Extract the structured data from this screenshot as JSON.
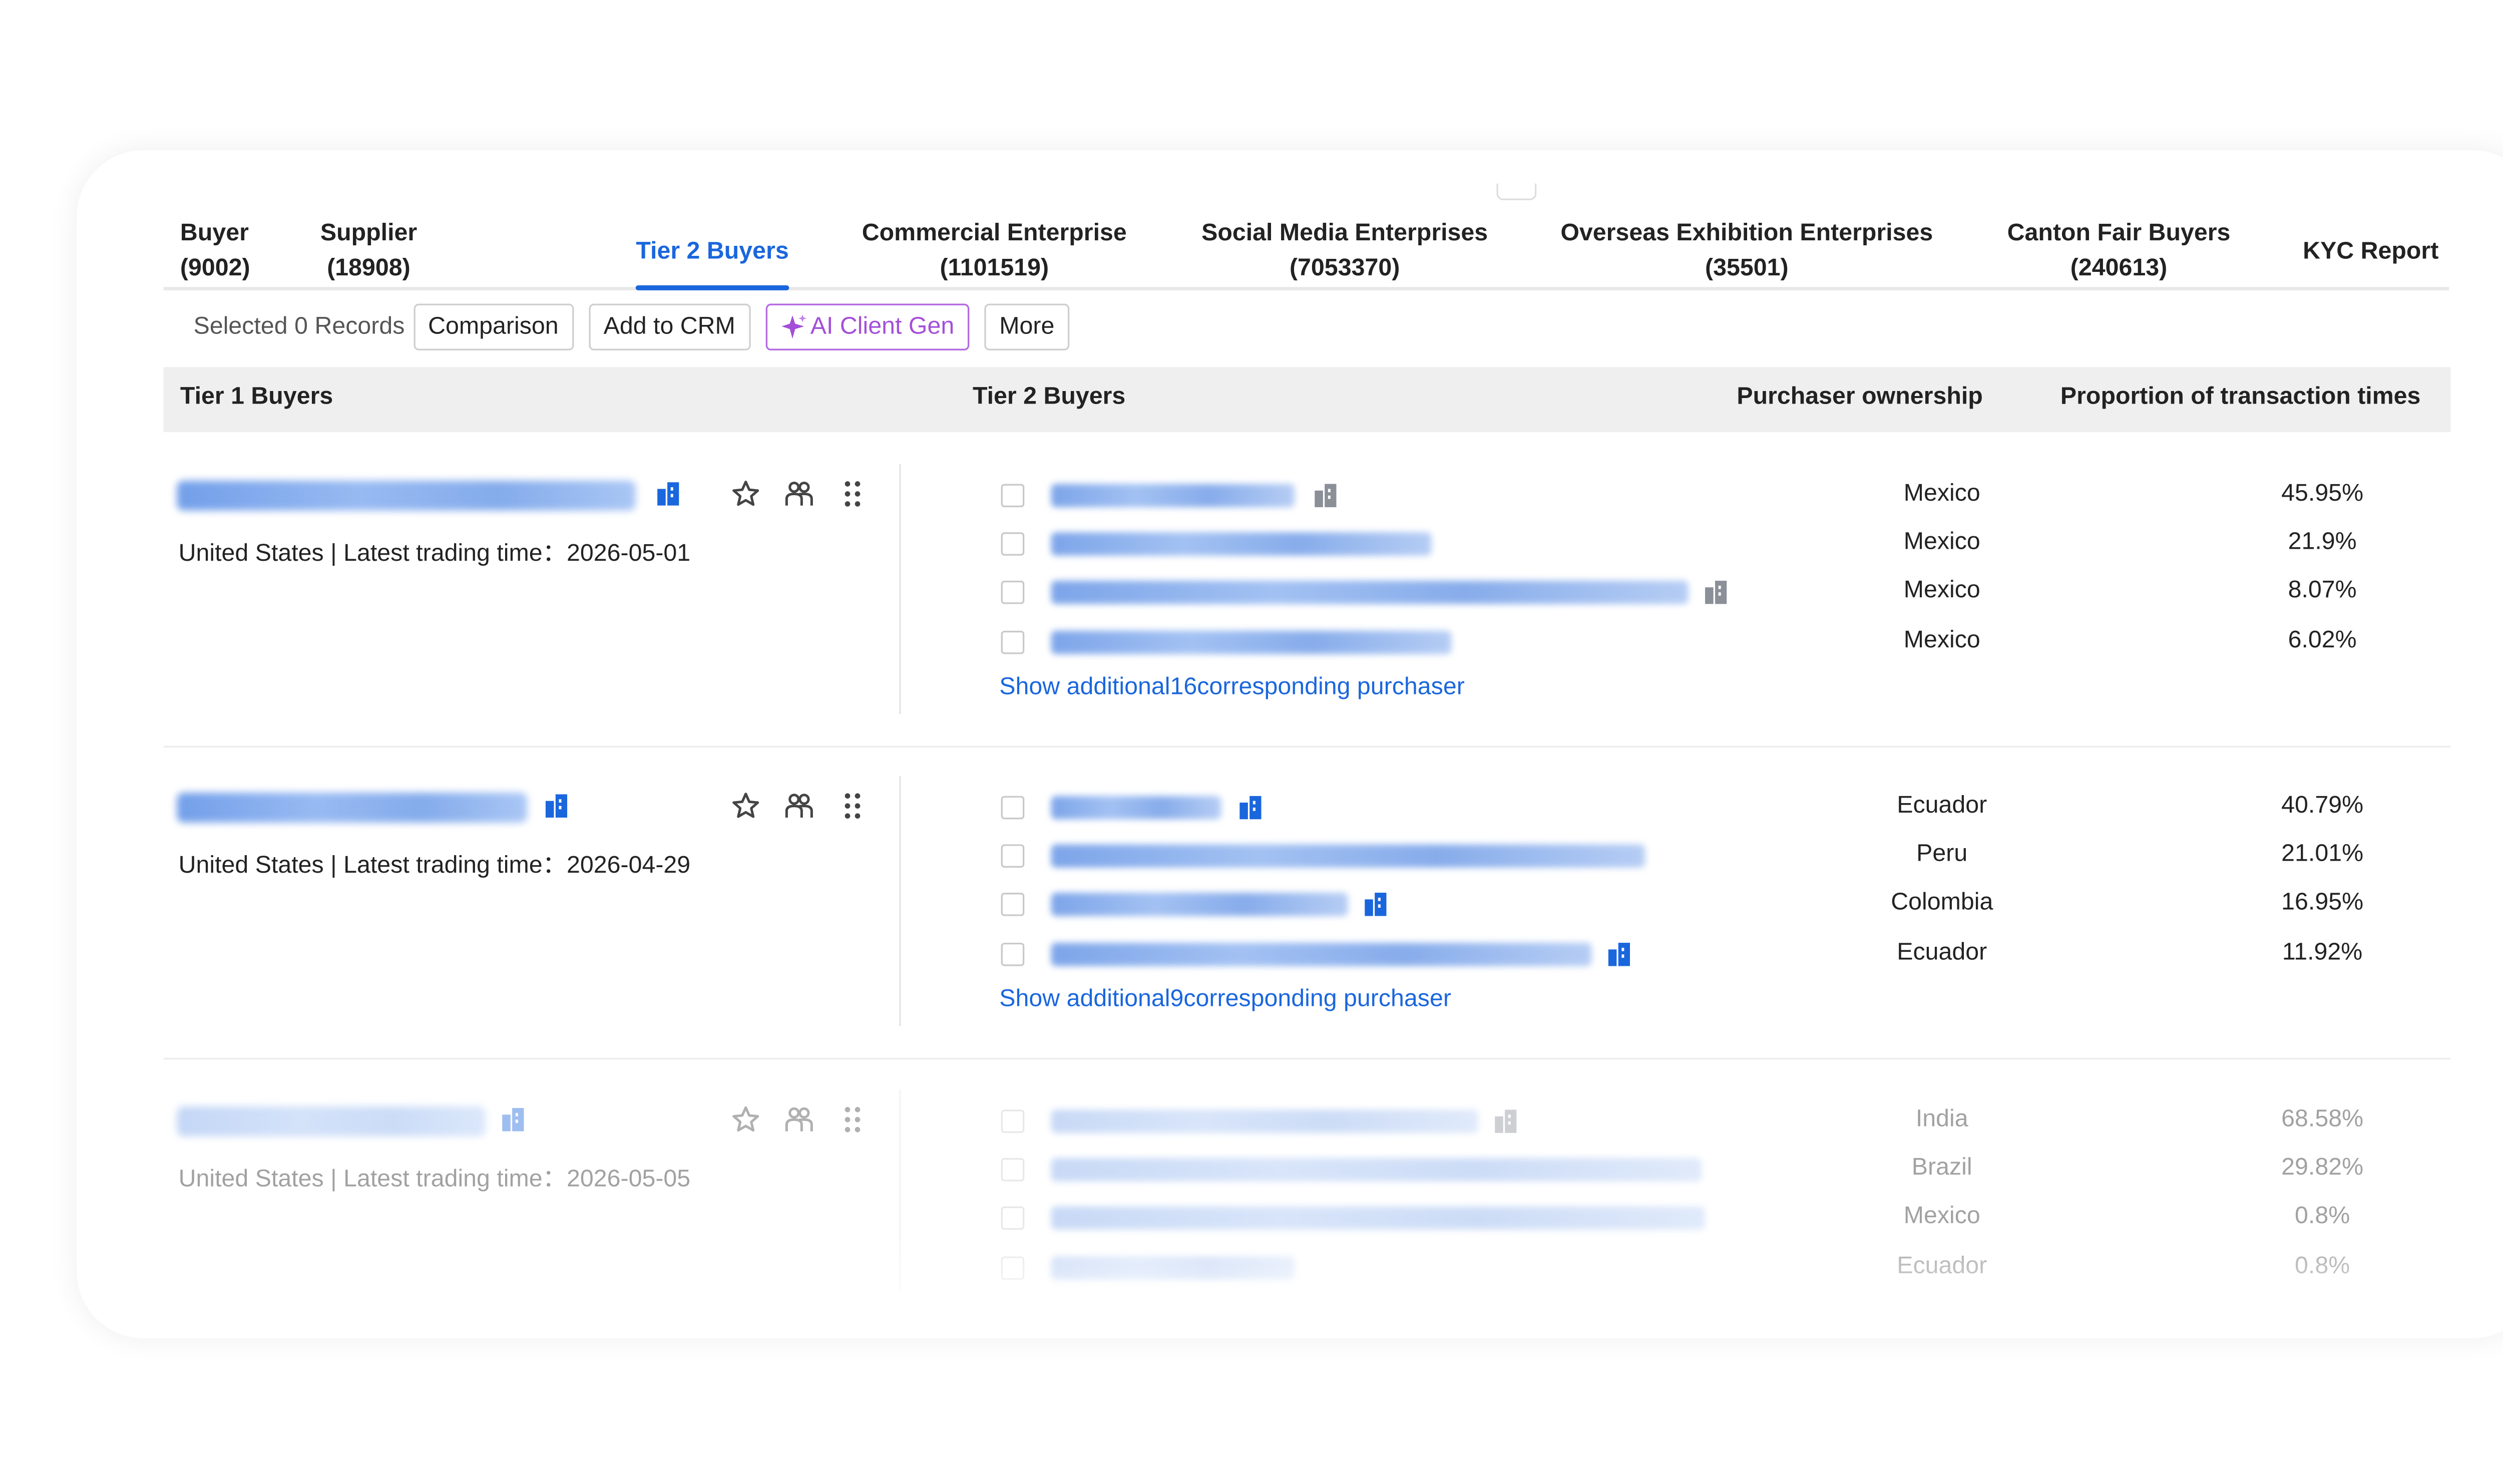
{
  "tabs": [
    {
      "label": "Buyer",
      "count": "(9002)"
    },
    {
      "label": "Supplier",
      "count": "(18908)"
    },
    {
      "label": "Tier 2 Buyers",
      "count": ""
    },
    {
      "label": "Commercial Enterprise",
      "count": "(1101519)"
    },
    {
      "label": "Social Media Enterprises",
      "count": "(7053370)"
    },
    {
      "label": "Overseas Exhibition Enterprises",
      "count": "(35501)"
    },
    {
      "label": "Canton Fair Buyers",
      "count": "(240613)"
    },
    {
      "label": "KYC Report",
      "count": ""
    }
  ],
  "active_tab": "Tier 2 Buyers",
  "toolbar": {
    "selected_prefix": "Selected",
    "selected_count": "0",
    "selected_suffix": "Records",
    "comparison": "Comparison",
    "add_crm": "Add to CRM",
    "ai_client_gen": "AI Client Gen",
    "more": "More"
  },
  "table": {
    "headers": {
      "tier1": "Tier 1 Buyers",
      "tier2": "Tier 2 Buyers",
      "ownership": "Purchaser ownership",
      "proportion": "Proportion of transaction times"
    },
    "rows": [
      {
        "meta": "United States | Latest trading time：2026-05-01",
        "purchasers": [
          {
            "country": "Mexico",
            "pct": "45.95%"
          },
          {
            "country": "Mexico",
            "pct": "21.9%"
          },
          {
            "country": "Mexico",
            "pct": "8.07%"
          },
          {
            "country": "Mexico",
            "pct": "6.02%"
          }
        ],
        "more": "Show additional16corresponding purchaser"
      },
      {
        "meta": "United States | Latest trading time：2026-04-29",
        "purchasers": [
          {
            "country": "Ecuador",
            "pct": "40.79%"
          },
          {
            "country": "Peru",
            "pct": "21.01%"
          },
          {
            "country": "Colombia",
            "pct": "16.95%"
          },
          {
            "country": "Ecuador",
            "pct": "11.92%"
          }
        ],
        "more": "Show additional9corresponding purchaser"
      },
      {
        "meta": "United States | Latest trading time：2026-05-05",
        "purchasers": [
          {
            "country": "India",
            "pct": "68.58%"
          },
          {
            "country": "Brazil",
            "pct": "29.82%"
          },
          {
            "country": "Mexico",
            "pct": "0.8%"
          },
          {
            "country": "Ecuador",
            "pct": "0.8%"
          }
        ]
      }
    ]
  },
  "colors": {
    "accent": "#1a66dd",
    "ai": "#a44fd8",
    "header_bg": "#efeff0"
  }
}
